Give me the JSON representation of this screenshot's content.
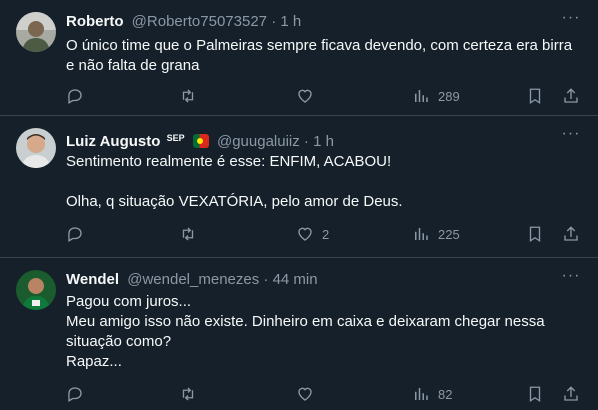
{
  "colors": {
    "background": "#15202b",
    "border": "#38444d",
    "text": "#f7f9f9",
    "muted": "#8b98a5"
  },
  "tweets": [
    {
      "name": "Roberto",
      "handle": "@Roberto75073527",
      "separator": "·",
      "time": "1 h",
      "text": "O único time que o Palmeiras sempre ficava devendo, com certeza era birra e não falta de grana",
      "likes": "",
      "views": "289",
      "avatar_icon": "person-photo-icon"
    },
    {
      "name": "Luiz Augusto",
      "badge": "SEP",
      "handle": "@guugaluiiz",
      "separator": "·",
      "time": "1 h",
      "text": "Sentimento realmente é esse: ENFIM, ACABOU!\n\nOlha, q situação VEXATÓRIA, pelo amor de Deus.",
      "likes": "2",
      "views": "225",
      "avatar_icon": "person-photo-icon"
    },
    {
      "name": "Wendel",
      "handle": "@wendel_menezes",
      "separator": "·",
      "time": "44 min",
      "text": "Pagou com juros...\nMeu amigo isso não existe. Dinheiro em caixa e deixaram chegar nessa situação como?\nRapaz...",
      "likes": "",
      "views": "82",
      "avatar_icon": "person-photo-icon"
    }
  ]
}
